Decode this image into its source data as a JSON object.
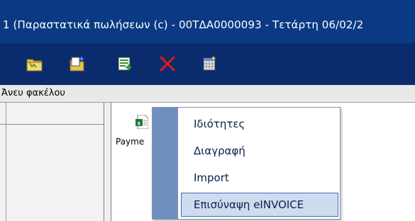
{
  "window": {
    "title": "1 (Παραστατικά πωλήσεων (c) - 00ΤΔΑ0000093 - Τετάρτη 06/02/2"
  },
  "toolbar": {
    "buttons": [
      {
        "icon": "folder-open-icon"
      },
      {
        "icon": "new-document-icon"
      },
      {
        "icon": "add-list-icon"
      },
      {
        "icon": "delete-x-icon"
      },
      {
        "icon": "properties-grid-icon"
      }
    ]
  },
  "folderbar": {
    "label": "Άνευ φακέλου"
  },
  "files": [
    {
      "name": "Payme",
      "icon": "excel-file-icon"
    }
  ],
  "context_menu": {
    "items": [
      {
        "label": "Ιδιότητες"
      },
      {
        "label": "Διαγραφή"
      },
      {
        "label": "Import"
      },
      {
        "label": "Επισύναψη eINVOICE",
        "highlighted": true
      }
    ]
  },
  "colors": {
    "title_bg": "#0a3a83",
    "toolbar_bg": "#0a2c6e",
    "menu_strip": "#6f8fbf",
    "menu_highlight": "#cfdbef"
  }
}
